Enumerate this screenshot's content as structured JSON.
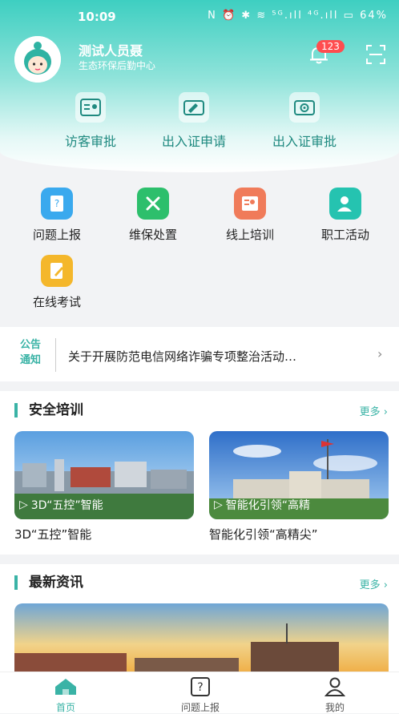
{
  "status_bar": {
    "time": "10:09",
    "battery": "64%",
    "icons": "N ⏰ ✱ ≋ ⁵ᴳ.ıll ⁴ᴳ.ıll ▭"
  },
  "user": {
    "name": "测试人员聂",
    "org": "生态环保后勤中心"
  },
  "notifications": {
    "count": "123"
  },
  "top_actions": [
    {
      "label": "访客审批",
      "icon": "visitor-card-icon"
    },
    {
      "label": "出入证申请",
      "icon": "pass-edit-icon"
    },
    {
      "label": "出入证审批",
      "icon": "pass-approve-icon"
    }
  ],
  "grid": [
    {
      "label": "问题上报",
      "icon": "report-icon",
      "color": "#3aa9ee"
    },
    {
      "label": "维保处置",
      "icon": "tools-icon",
      "color": "#2dbf6c"
    },
    {
      "label": "线上培训",
      "icon": "training-icon",
      "color": "#f07b5a"
    },
    {
      "label": "职工活动",
      "icon": "staff-activity-icon",
      "color": "#25c3b0"
    },
    {
      "label": "在线考试",
      "icon": "exam-icon",
      "color": "#f4b72b"
    }
  ],
  "notice": {
    "tag_top": "公告",
    "tag_bottom": "通知",
    "text": "关于开展防范电信网络诈骗专项整治活动…"
  },
  "safety_training": {
    "title": "安全培训",
    "more": "更多",
    "items": [
      {
        "caption": "3D“五控”智能",
        "title": "3D“五控”智能"
      },
      {
        "caption": "智能化引领“高精",
        "title": "智能化引领“高精尖”"
      }
    ]
  },
  "news": {
    "title": "最新资讯",
    "more": "更多"
  },
  "tabbar": [
    {
      "label": "首页",
      "active": true
    },
    {
      "label": "问题上报",
      "active": false
    },
    {
      "label": "我的",
      "active": false
    }
  ],
  "colors": {
    "accent": "#3ab3a6",
    "badge": "#ff4d4f"
  }
}
